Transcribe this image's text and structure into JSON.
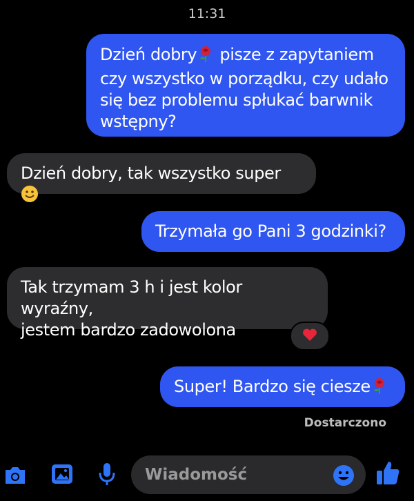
{
  "header": {
    "time": "11:31"
  },
  "messages": [
    {
      "side": "out",
      "text": "Dzień dobry",
      "emoji": "rose-emoji",
      "text_after": " pisze z zapytaniem\nczy wszystko w porządku, czy udało\nsię bez problemu spłukać barwnik\nwstępny?"
    },
    {
      "side": "in",
      "text": "Dzień dobry, tak wszystko super ",
      "emoji": "smiling-face-emoji"
    },
    {
      "side": "out",
      "text": "Trzymała go Pani 3 godzinki?"
    },
    {
      "side": "in",
      "text": "Tak trzymam 3 h i jest kolor wyraźny,\njestem bardzo zadowolona",
      "reaction": "red-heart"
    },
    {
      "side": "out",
      "text": "Super! Bardzo się ciesze",
      "emoji": "rose-emoji"
    }
  ],
  "status": "Dostarczono",
  "composer": {
    "placeholder": "Wiadomość"
  },
  "colors": {
    "outgoing": "#2f56f0",
    "incoming": "#2d2d2f",
    "accent": "#2f74f7"
  },
  "icons": [
    "camera-icon",
    "gallery-icon",
    "microphone-icon",
    "emoji-icon",
    "thumbs-up-icon"
  ]
}
